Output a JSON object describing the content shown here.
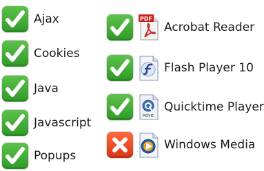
{
  "features": [
    {
      "label": "Ajax",
      "status": "supported",
      "status_icon": "checkmark-icon"
    },
    {
      "label": "Cookies",
      "status": "supported",
      "status_icon": "checkmark-icon"
    },
    {
      "label": "Java",
      "status": "supported",
      "status_icon": "checkmark-icon"
    },
    {
      "label": "Javascript",
      "status": "supported",
      "status_icon": "checkmark-icon"
    },
    {
      "label": "Popups",
      "status": "supported",
      "status_icon": "checkmark-icon"
    }
  ],
  "plugins": [
    {
      "label": "Acrobat Reader",
      "status": "supported",
      "status_icon": "checkmark-icon",
      "app_icon": "acrobat-pdf-icon",
      "app_icon_text": "PDF"
    },
    {
      "label": "Flash Player 10",
      "status": "supported",
      "status_icon": "checkmark-icon",
      "app_icon": "flash-player-icon"
    },
    {
      "label": "Quicktime Player",
      "status": "supported",
      "status_icon": "checkmark-icon",
      "app_icon": "quicktime-movie-icon",
      "app_icon_text": "MOVIE"
    },
    {
      "label": "Windows Media",
      "status": "not-supported",
      "status_icon": "x-icon",
      "app_icon": "windows-media-icon"
    }
  ],
  "colors": {
    "ok": "#3aa82f",
    "error": "#e2421c",
    "text": "#1a1a1a"
  }
}
